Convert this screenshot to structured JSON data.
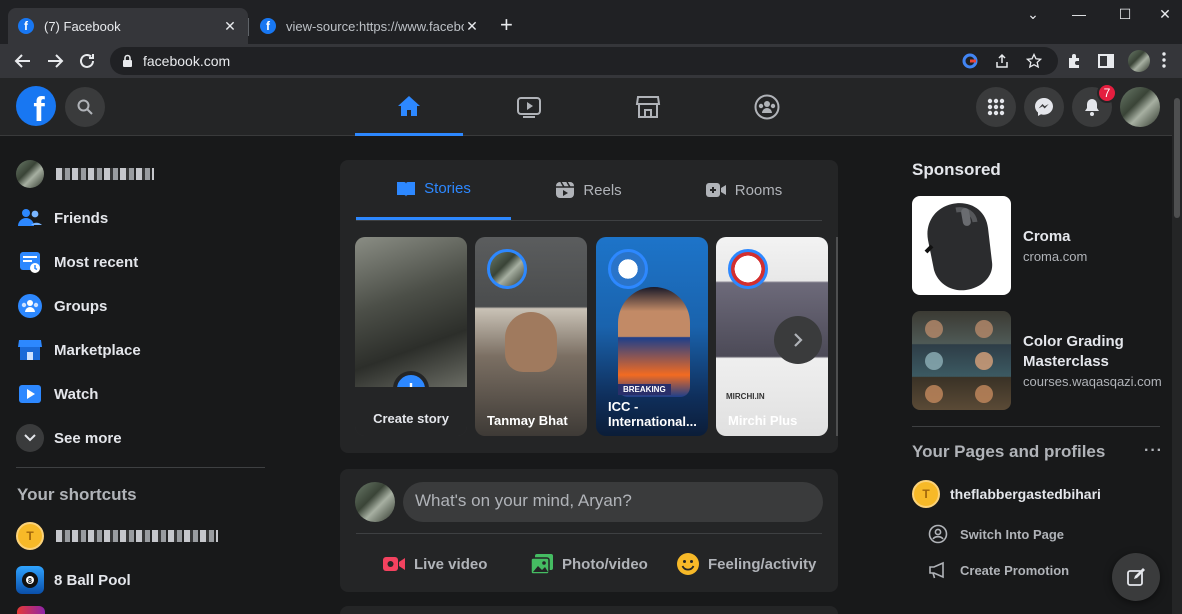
{
  "browser": {
    "tabs": [
      {
        "title": "(7) Facebook",
        "favicon": "facebook-icon",
        "active": true
      },
      {
        "title": "view-source:https://www.faceboo",
        "favicon": "facebook-icon",
        "active": false
      }
    ],
    "new_tab": "+",
    "url": "facebook.com"
  },
  "header": {
    "nav": [
      "home-icon",
      "watch-icon",
      "marketplace-icon",
      "groups-icon"
    ],
    "notifications_count": "7"
  },
  "left": {
    "items": [
      {
        "label": "Friends",
        "icon": "friends-icon"
      },
      {
        "label": "Most recent",
        "icon": "feed-icon"
      },
      {
        "label": "Groups",
        "icon": "groups-icon"
      },
      {
        "label": "Marketplace",
        "icon": "marketplace-icon"
      },
      {
        "label": "Watch",
        "icon": "watch-icon"
      },
      {
        "label": "See more",
        "icon": "chevron-down-icon"
      }
    ],
    "shortcuts_title": "Your shortcuts",
    "shortcuts": [
      {
        "label": "8 Ball Pool",
        "icon": "8-ball-pool-icon"
      }
    ]
  },
  "stories": {
    "tabs": [
      {
        "label": "Stories",
        "icon": "book-icon"
      },
      {
        "label": "Reels",
        "icon": "reels-icon"
      },
      {
        "label": "Rooms",
        "icon": "video-camera-icon"
      }
    ],
    "cards": [
      {
        "name": "Create story"
      },
      {
        "name": "Tanmay Bhat"
      },
      {
        "name": "ICC - International..."
      },
      {
        "name": "Mirchi Plus"
      }
    ],
    "icc_breaking": "BREAKING",
    "mirchi_label": "MIRCHI.IN"
  },
  "composer": {
    "placeholder": "What's on your mind, Aryan?",
    "actions": [
      {
        "label": "Live video",
        "icon": "live-video-icon",
        "color": "#f3425f"
      },
      {
        "label": "Photo/video",
        "icon": "photo-icon",
        "color": "#45bd62"
      },
      {
        "label": "Feeling/activity",
        "icon": "smiley-icon",
        "color": "#f7b928"
      }
    ]
  },
  "right": {
    "sponsored_title": "Sponsored",
    "ads": [
      {
        "title": "Croma",
        "url": "croma.com"
      },
      {
        "title": "Color Grading Masterclass",
        "url": "courses.waqasqazi.com"
      }
    ],
    "pages_title": "Your Pages and profiles",
    "page_name": "theflabbergastedbihari",
    "page_actions": [
      {
        "label": "Switch Into Page",
        "icon": "switch-profile-icon"
      },
      {
        "label": "Create Promotion",
        "icon": "megaphone-icon"
      }
    ]
  },
  "colors": {
    "accent": "#2d88ff",
    "bg": "#18191a",
    "surface": "#242526"
  }
}
